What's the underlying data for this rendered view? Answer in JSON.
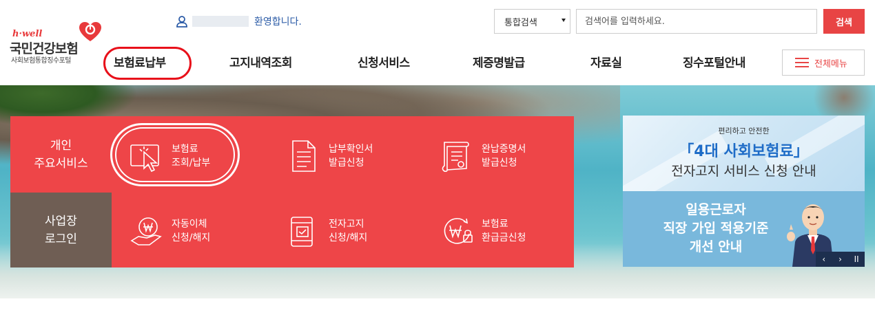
{
  "header": {
    "logo": {
      "tagline": "h·well",
      "brand": "국민건강보험",
      "sub": "사회보험통합징수포털"
    },
    "welcome": {
      "text": "환영합니다."
    },
    "search": {
      "scope_selected": "통합검색",
      "placeholder": "검색어를 입력하세요.",
      "button": "검색"
    },
    "nav": [
      {
        "label": "보험료납부"
      },
      {
        "label": "고지내역조회"
      },
      {
        "label": "신청서비스"
      },
      {
        "label": "제증명발급"
      },
      {
        "label": "자료실"
      },
      {
        "label": "징수포털안내"
      }
    ],
    "all_menu": "전체메뉴"
  },
  "hero": {
    "tabs": {
      "personal": "개인\n주요서비스",
      "business": "사업장\n로그인"
    },
    "services": [
      {
        "label": "보험료\n조회/납부",
        "icon": "cursor-click-icon"
      },
      {
        "label": "납부확인서\n발급신청",
        "icon": "document-icon"
      },
      {
        "label": "완납증명서\n발급신청",
        "icon": "certificate-scroll-icon"
      },
      {
        "label": "자동이체\n신청/해지",
        "icon": "coin-hand-icon"
      },
      {
        "label": "전자고지\n신청/해지",
        "icon": "mobile-check-icon"
      },
      {
        "label": "보험료\n환급금신청",
        "icon": "refund-coin-icon"
      }
    ],
    "banner1": {
      "small": "편리하고 안전한",
      "title": "「4대 사회보험료」",
      "sub": "전자고지 서비스 신청 안내"
    },
    "banner2": {
      "text": "일용근로자\n직장 가입 적용기준\n개선 안내"
    },
    "controls": {
      "prev": "‹",
      "next": "›",
      "pause": "II"
    }
  },
  "colors": {
    "accent": "#ee4548",
    "biz_tab": "#6f5e54",
    "link_blue": "#2a5aa6",
    "highlight": "#e8101a"
  }
}
